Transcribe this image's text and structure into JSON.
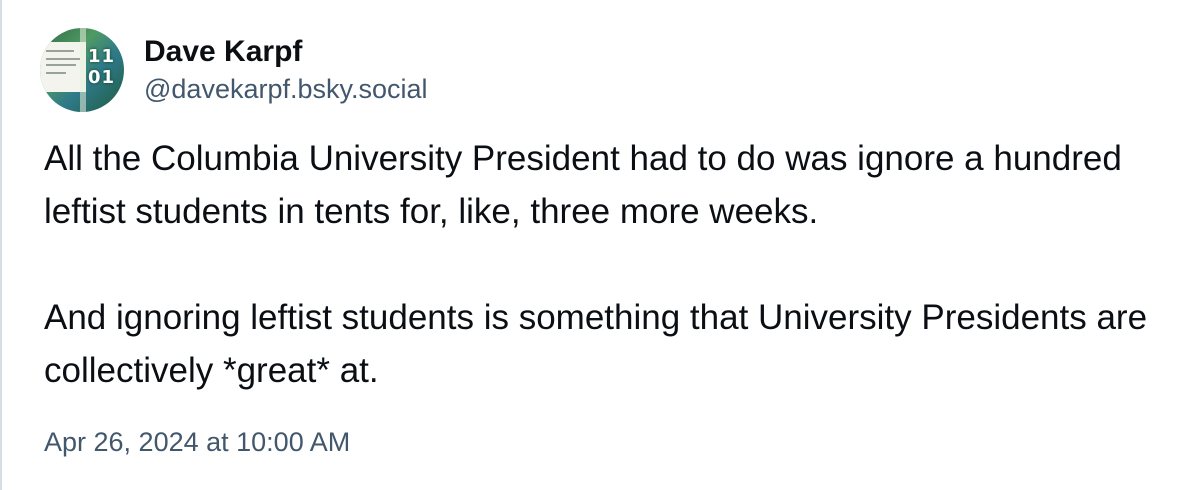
{
  "author": {
    "display_name": "Dave Karpf",
    "handle": "@davekarpf.bsky.social",
    "avatar_icon": "profile-photo-icon",
    "avatar_digits": "11 01"
  },
  "post": {
    "paragraphs": [
      "All the Columbia University President had to do was ignore a hundred leftist students in tents for, like, three more weeks.",
      "And ignoring leftist students is something that University Presidents are collectively *great* at."
    ],
    "timestamp": "Apr 26, 2024 at 10:00 AM"
  },
  "colors": {
    "text": "#0b0f14",
    "secondary_text": "#42576c",
    "border": "#d6dde5",
    "background": "#ffffff"
  }
}
